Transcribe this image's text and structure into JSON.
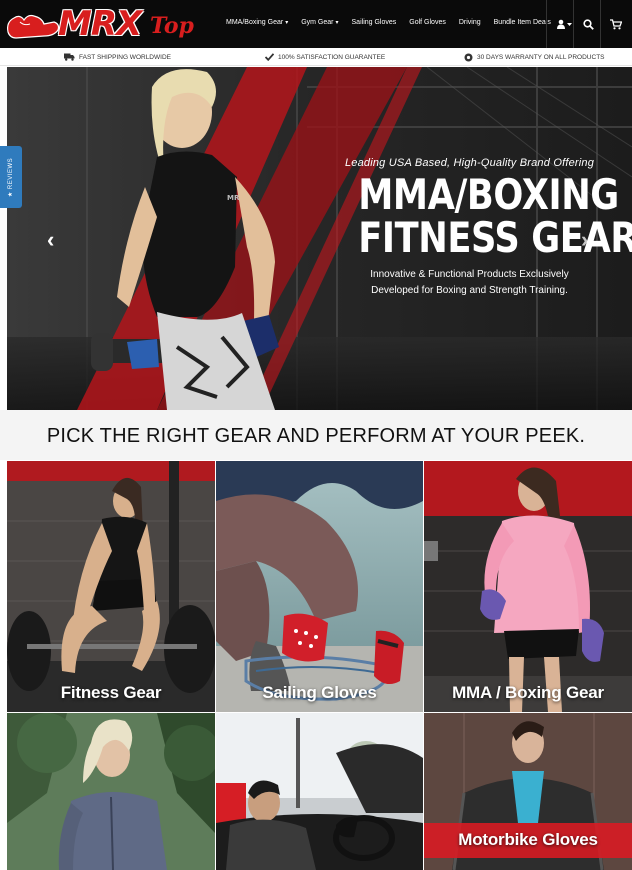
{
  "brand": {
    "logo_text": "MRX",
    "logo_suffix": "Top",
    "accent_color": "#d81e1e"
  },
  "nav": {
    "items": [
      {
        "label": "MMA/Boxing Gear",
        "has_dropdown": true
      },
      {
        "label": "Gym Gear",
        "has_dropdown": true
      },
      {
        "label": "Sailing Gloves",
        "has_dropdown": false
      },
      {
        "label": "Golf Gloves",
        "has_dropdown": false
      },
      {
        "label": "Driving",
        "has_dropdown": false
      },
      {
        "label": "Bundle Item Deals",
        "has_dropdown": false
      }
    ],
    "caret": "▾",
    "icons": [
      "user-icon",
      "search-icon",
      "cart-icon"
    ]
  },
  "promo": {
    "shipping": "FAST SHIPPING WORLDWIDE",
    "satisfaction": "100% SATISFACTION GUARANTEE",
    "warranty": "30 DAYS WARRANTY ON ALL PRODUCTS"
  },
  "reviews_tab": {
    "label": "★ REVIEWS"
  },
  "hero": {
    "kicker": "Leading USA Based, High-Quality Brand Offering",
    "title_line1": "MMA/BOXING",
    "title_line2": "FITNESS GEAR",
    "subtitle_line1": "Innovative & Functional Products Exclusively",
    "subtitle_line2": "Developed for  Boxing and Strength Training.",
    "prev_arrow": "‹",
    "next_arrow": "›",
    "shirt_logo": "MRX"
  },
  "headline": "PICK THE RIGHT GEAR AND PERFORM AT YOUR PEEK.",
  "categories": [
    {
      "label": "Fitness Gear"
    },
    {
      "label": "Sailing Gloves"
    },
    {
      "label": "MMA / Boxing Gear"
    },
    {
      "label": ""
    },
    {
      "label": ""
    },
    {
      "label": "Motorbike Gloves"
    }
  ]
}
